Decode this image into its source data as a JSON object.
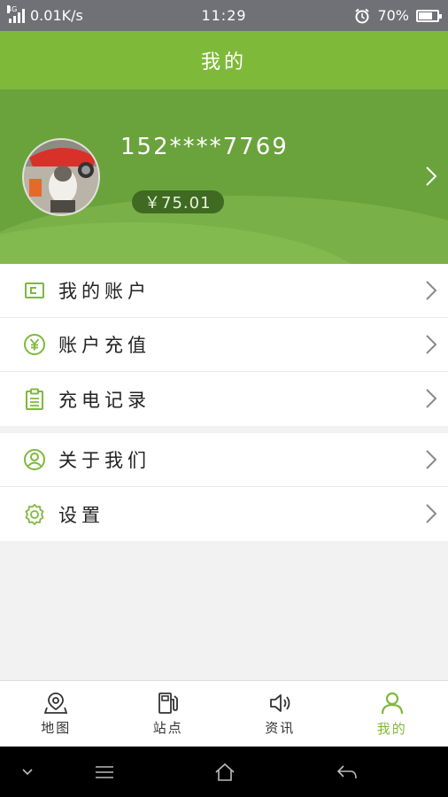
{
  "status_bar": {
    "network": "4G",
    "speed": "0.01K/s",
    "time": "11:29",
    "battery": "70%",
    "battery_level": 0.7
  },
  "header": {
    "title": "我的"
  },
  "profile": {
    "phone": "152****7769",
    "balance": "￥75.01"
  },
  "menu_group_1": [
    {
      "label": "我的账户",
      "icon": "wallet-icon"
    },
    {
      "label": "账户充值",
      "icon": "yuan-circle-icon"
    },
    {
      "label": "充电记录",
      "icon": "clipboard-icon"
    }
  ],
  "menu_group_2": [
    {
      "label": "关于我们",
      "icon": "person-circle-icon"
    },
    {
      "label": "设置",
      "icon": "gear-icon"
    }
  ],
  "tabs": [
    {
      "label": "地图",
      "icon": "map-pin-icon",
      "active": false
    },
    {
      "label": "站点",
      "icon": "fuel-station-icon",
      "active": false
    },
    {
      "label": "资讯",
      "icon": "speaker-icon",
      "active": false
    },
    {
      "label": "我的",
      "icon": "person-icon",
      "active": true
    }
  ],
  "colors": {
    "accent": "#7fb93a",
    "banner": "#6aa33c",
    "balance_pill": "#3f6a22"
  }
}
